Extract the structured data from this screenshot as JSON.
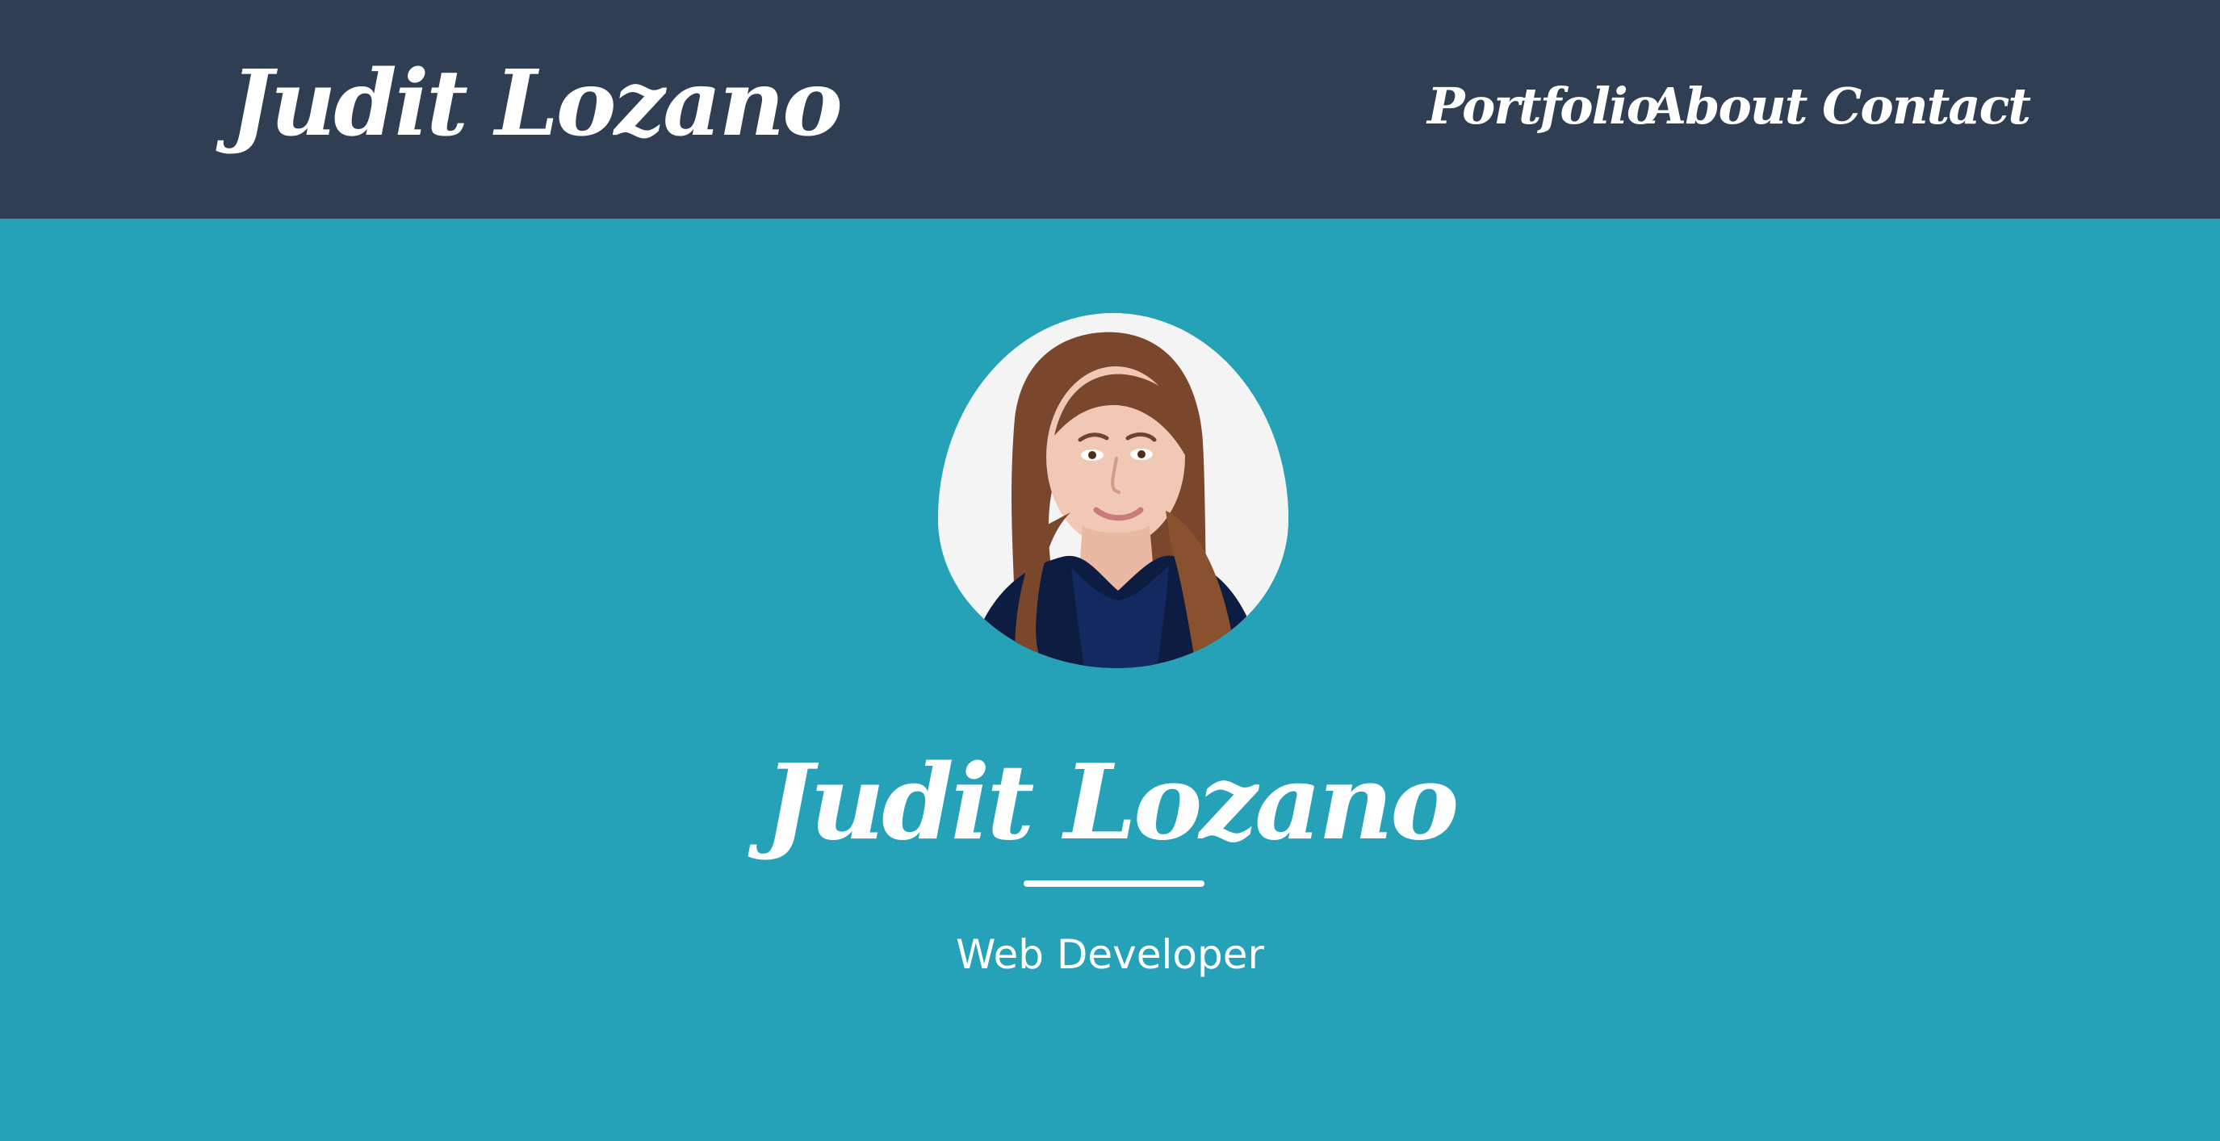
{
  "header": {
    "brand": "Judit Lozano",
    "nav": [
      {
        "label": "Portfolio"
      },
      {
        "label": "About"
      },
      {
        "label": "Contact"
      }
    ]
  },
  "hero": {
    "name": "Judit Lozano",
    "subtitle": "Web Developer"
  },
  "colors": {
    "header_bg": "#2f3e53",
    "hero_bg": "#25a2b8",
    "text": "#ffffff",
    "navy": "#0d1d42",
    "hair": "#6b3a22"
  }
}
